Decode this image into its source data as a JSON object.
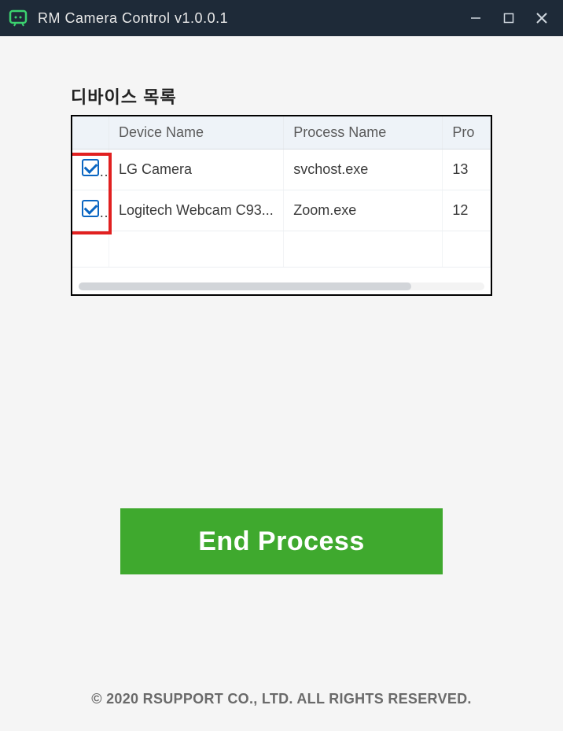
{
  "window": {
    "title": "RM Camera Control v1.0.0.1"
  },
  "section": {
    "title": "디바이스 목록"
  },
  "table": {
    "headers": {
      "check": "",
      "device": "Device Name",
      "process": "Process Name",
      "pid": "Pro"
    },
    "rows": [
      {
        "checked": true,
        "device": "LG Camera",
        "process": "svchost.exe",
        "pid": "13"
      },
      {
        "checked": true,
        "device": "Logitech Webcam C93...",
        "process": "Zoom.exe",
        "pid": "12"
      }
    ]
  },
  "actions": {
    "end_process": "End Process"
  },
  "footer": {
    "copyright": "© 2020 RSUPPORT CO., LTD. ALL RIGHTS RESERVED."
  },
  "colors": {
    "accent_green": "#3fa92e",
    "titlebar_bg": "#1e2a38",
    "highlight_red": "#e12020",
    "checkbox_blue": "#0a66c2"
  }
}
